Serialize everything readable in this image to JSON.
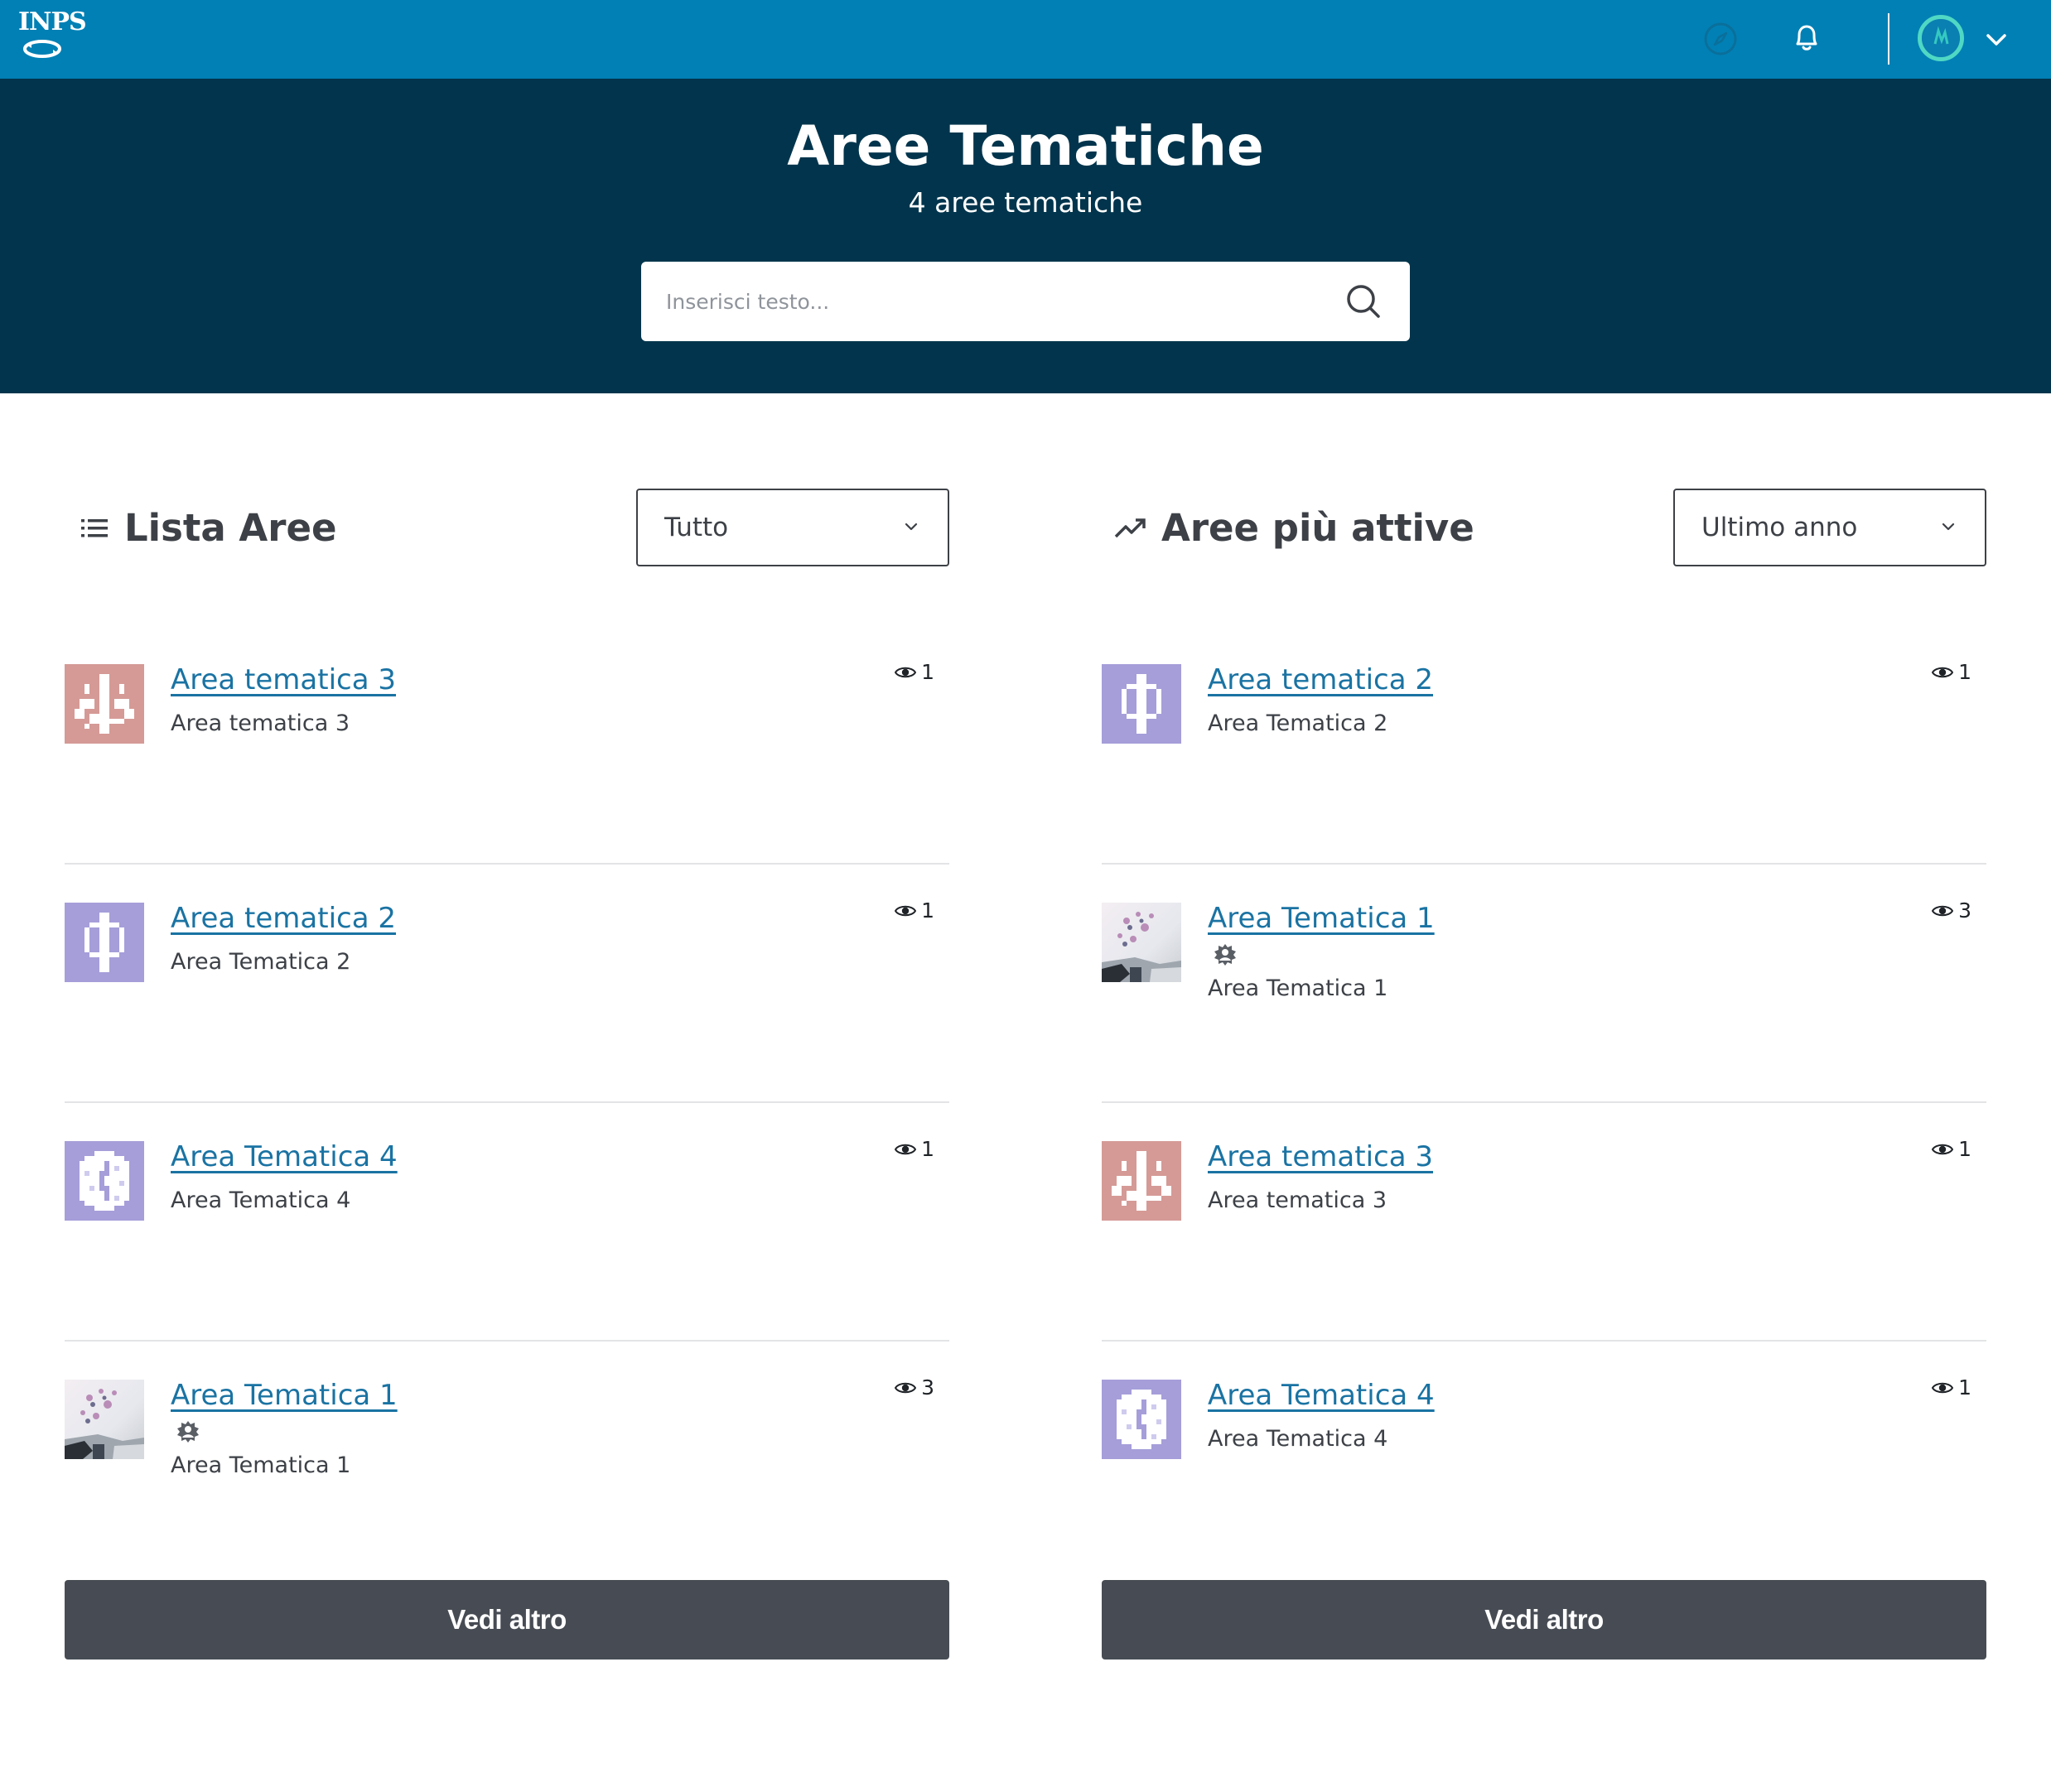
{
  "navbar": {
    "logo_text": "INPS",
    "icons": [
      "compass-icon",
      "bell-icon",
      "avatar-icon",
      "chevron-down-icon"
    ]
  },
  "hero": {
    "title": "Aree Tematiche",
    "subtitle": "4 aree tematiche",
    "search_placeholder": "Inserisci testo..."
  },
  "lista": {
    "title": "Lista Aree",
    "filter_value": "Tutto",
    "more_label": "Vedi altro",
    "items": [
      {
        "title": "Area tematica 3",
        "description": "Area tematica 3",
        "views": "1",
        "thumb": "coral",
        "badge": false
      },
      {
        "title": "Area tematica 2",
        "description": "Area Tematica 2",
        "views": "1",
        "thumb": "violet-phi",
        "badge": false
      },
      {
        "title": "Area Tematica 4",
        "description": "Area Tematica 4",
        "views": "1",
        "thumb": "violet-leaf",
        "badge": false
      },
      {
        "title": "Area Tematica 1",
        "description": "Area Tematica 1",
        "views": "3",
        "thumb": "photo",
        "badge": true
      }
    ]
  },
  "attive": {
    "title": "Aree più attive",
    "filter_value": "Ultimo anno",
    "more_label": "Vedi altro",
    "items": [
      {
        "title": "Area tematica 2",
        "description": "Area Tematica 2",
        "views": "1",
        "thumb": "violet-phi",
        "badge": false
      },
      {
        "title": "Area Tematica 1",
        "description": "Area Tematica 1",
        "views": "3",
        "thumb": "photo",
        "badge": true
      },
      {
        "title": "Area tematica 3",
        "description": "Area tematica 3",
        "views": "1",
        "thumb": "coral",
        "badge": false
      },
      {
        "title": "Area Tematica 4",
        "description": "Area Tematica 4",
        "views": "1",
        "thumb": "violet-leaf",
        "badge": false
      }
    ]
  },
  "colors": {
    "navbar": "#0180b5",
    "hero": "#02354d",
    "link": "#1a73a3",
    "button": "#474c54",
    "thumb_coral": "#d59a96",
    "thumb_violet": "#a59ed9"
  }
}
